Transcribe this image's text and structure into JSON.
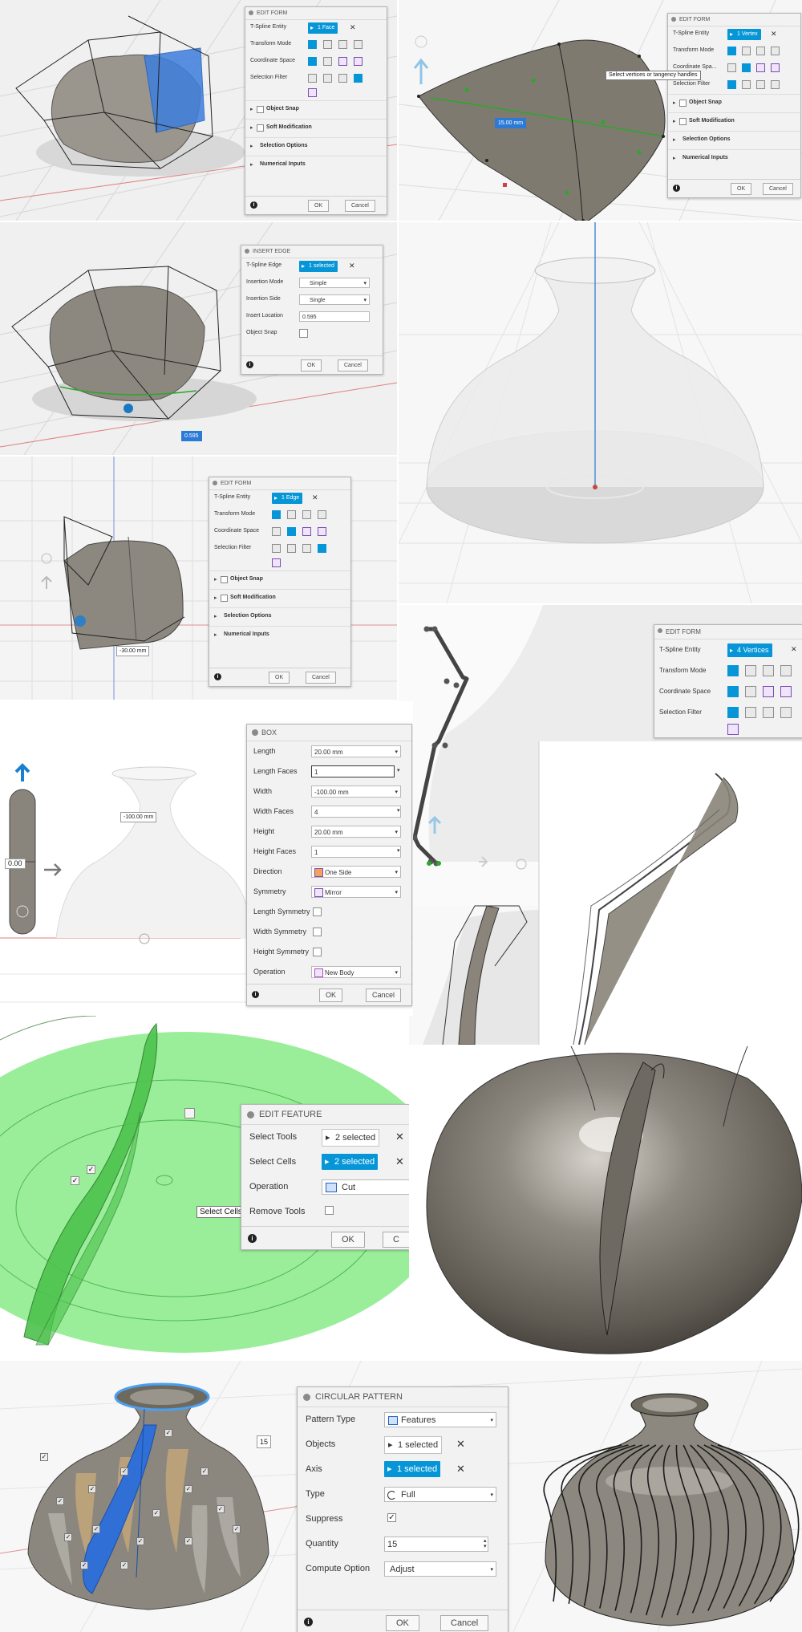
{
  "panel1": {
    "dialog": {
      "title": "EDIT FORM",
      "tspline_label": "T-Spline Entity",
      "tspline_value": "1 Face",
      "transform_mode_label": "Transform Mode",
      "coord_space_label": "Coordinate Space",
      "selection_filter_label": "Selection Filter",
      "object_snap": "Object Snap",
      "soft_mod": "Soft Modification",
      "selection_options": "Selection Options",
      "numerical_inputs": "Numerical Inputs",
      "ok": "OK",
      "cancel": "Cancel"
    }
  },
  "panel2": {
    "dialog": {
      "title": "EDIT FORM",
      "tspline_label": "T-Spline Entity",
      "tspline_value": "1 Vertex",
      "transform_mode_label": "Transform Mode",
      "coord_space_label": "Coordinate Spa...",
      "selection_filter_label": "Selection Filter",
      "object_snap": "Object Snap",
      "soft_mod": "Soft Modification",
      "selection_options": "Selection Options",
      "numerical_inputs": "Numerical Inputs",
      "ok": "OK",
      "cancel": "Cancel"
    },
    "tooltip": "Select vertices or tangency handles",
    "value_tag": "15.00 mm"
  },
  "panel3": {
    "dialog": {
      "title": "INSERT EDGE",
      "tspline_label": "T-Spline Edge",
      "tspline_value": "1 selected",
      "insertion_mode_label": "Insertion Mode",
      "insertion_mode_value": "Simple",
      "insertion_side_label": "Insertion Side",
      "insertion_side_value": "Single",
      "insert_location_label": "Insert Location",
      "insert_location_value": "0.595",
      "object_snap_label": "Object Snap",
      "ok": "OK",
      "cancel": "Cancel"
    },
    "value_tag": "0.595"
  },
  "panel5": {
    "dialog": {
      "title": "EDIT FORM",
      "tspline_label": "T-Spline Entity",
      "tspline_value": "1 Edge",
      "transform_mode_label": "Transform Mode",
      "coord_space_label": "Coordinate Space",
      "selection_filter_label": "Selection Filter",
      "object_snap": "Object Snap",
      "soft_mod": "Soft Modification",
      "selection_options": "Selection Options",
      "numerical_inputs": "Numerical Inputs",
      "ok": "OK",
      "cancel": "Cancel"
    },
    "value_tag": "-30.00 mm"
  },
  "panel6": {
    "dialog": {
      "title": "EDIT FORM",
      "tspline_label": "T-Spline Entity",
      "tspline_value": "4 Vertices",
      "transform_mode_label": "Transform Mode",
      "coord_space_label": "Coordinate Space",
      "selection_filter_label": "Selection Filter"
    }
  },
  "panel7": {
    "dialog": {
      "title": "BOX",
      "rows": [
        {
          "label": "Length",
          "value": "20.00 mm"
        },
        {
          "label": "Length Faces",
          "value": "1"
        },
        {
          "label": "Width",
          "value": "-100.00 mm"
        },
        {
          "label": "Width Faces",
          "value": "4"
        },
        {
          "label": "Height",
          "value": "20.00 mm"
        },
        {
          "label": "Height Faces",
          "value": "1"
        },
        {
          "label": "Direction",
          "value": "One Side"
        },
        {
          "label": "Symmetry",
          "value": "Mirror"
        },
        {
          "label": "Length Symmetry",
          "value": ""
        },
        {
          "label": "Width Symmetry",
          "value": ""
        },
        {
          "label": "Height Symmetry",
          "value": ""
        },
        {
          "label": "Operation",
          "value": "New Body"
        }
      ],
      "ok": "OK",
      "cancel": "Cancel"
    },
    "value_tag": "-100.00 mm",
    "side_tag": "0.00"
  },
  "panel9": {
    "dialog": {
      "title": "EDIT FEATURE",
      "select_tools_label": "Select Tools",
      "select_tools_value": "2 selected",
      "select_cells_label": "Select Cells",
      "select_cells_value": "2 selected",
      "operation_label": "Operation",
      "operation_value": "Cut",
      "remove_tools_label": "Remove Tools",
      "ok": "OK",
      "cancel": "C"
    },
    "tooltip": "Select Cells"
  },
  "panel11": {
    "dialog": {
      "title": "CIRCULAR PATTERN",
      "pattern_type_label": "Pattern Type",
      "pattern_type_value": "Features",
      "objects_label": "Objects",
      "objects_value": "1 selected",
      "axis_label": "Axis",
      "axis_value": "1 selected",
      "type_label": "Type",
      "type_value": "Full",
      "suppress_label": "Suppress",
      "quantity_label": "Quantity",
      "quantity_value": "15",
      "compute_label": "Compute Option",
      "compute_value": "Adjust",
      "ok": "OK",
      "cancel": "Cancel"
    },
    "value_tag": "15"
  },
  "colors": {
    "accent": "#0696d7",
    "selection_blue": "#2b7ad6",
    "green_cells": "#5fe05f",
    "metal": "#8a857c"
  }
}
